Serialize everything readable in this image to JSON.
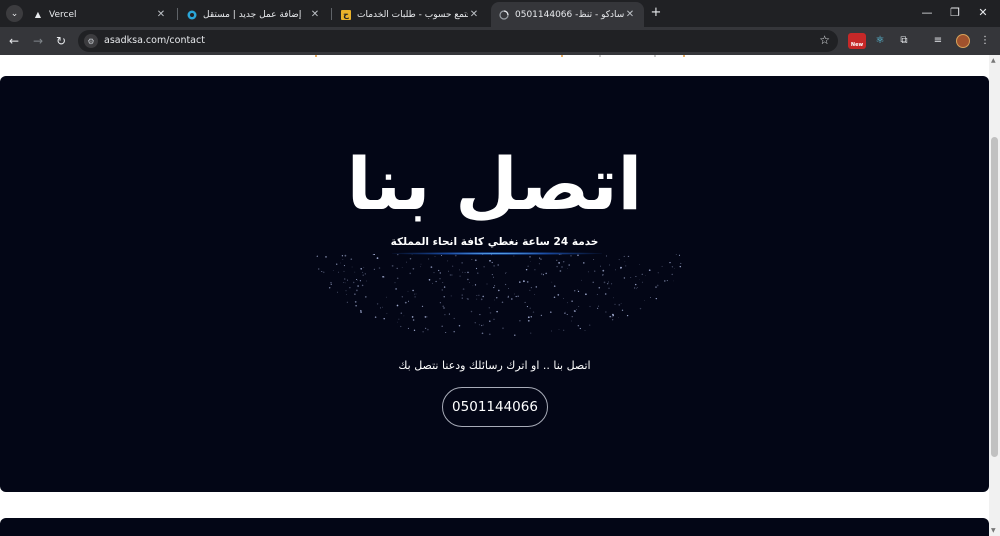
{
  "browser": {
    "tabs": [
      {
        "title": "Vercel",
        "favicon_icon": "vercel-triangle-icon"
      },
      {
        "title": "إضافة عمل جديد | مستقل",
        "favicon_icon": "mostaql-icon"
      },
      {
        "title": "مجتمع حسوب - طلبات الخدمات",
        "favicon_icon": "hsoub-icon"
      },
      {
        "title": "0501144066 -شركة اسادكو - تنظ",
        "favicon_icon": "loading-icon",
        "active": true
      }
    ],
    "url": "asadksa.com/contact",
    "extension_badge": "New"
  },
  "hero": {
    "title": "اتصل بنا",
    "subtitle": "خدمة 24 ساعة نغطي كافة انحاء المملكة",
    "description": "اتصل بنا .. او اترك رسائلك ودعنا نتصل بك",
    "phone": "0501144066"
  },
  "colors": {
    "hero_bg": "#030616",
    "tab_strip": "#202124",
    "toolbar": "#35363a"
  }
}
